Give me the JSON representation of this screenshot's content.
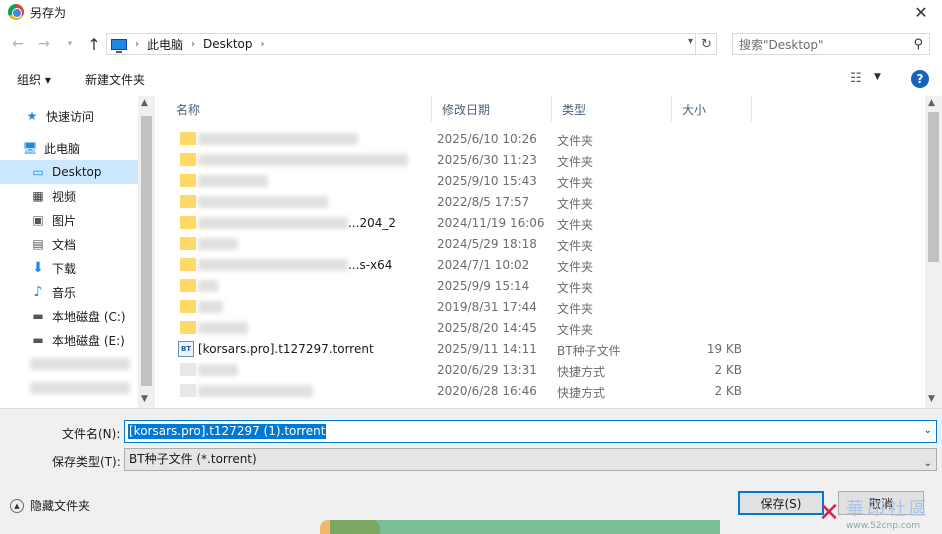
{
  "window": {
    "title": "另存为"
  },
  "address": {
    "crumbs": [
      "此电脑",
      "Desktop"
    ]
  },
  "search": {
    "placeholder": "搜索\"Desktop\""
  },
  "toolbar": {
    "organize": "组织 ▾",
    "new_folder": "新建文件夹"
  },
  "nav": {
    "items": [
      {
        "label": "快速访问",
        "icon": "star-icon"
      },
      {
        "label": "此电脑",
        "icon": "pc-icon"
      },
      {
        "label": "Desktop",
        "icon": "desktop-icon",
        "selected": true
      },
      {
        "label": "视频",
        "icon": "video-icon"
      },
      {
        "label": "图片",
        "icon": "picture-icon"
      },
      {
        "label": "文档",
        "icon": "document-icon"
      },
      {
        "label": "下载",
        "icon": "download-icon"
      },
      {
        "label": "音乐",
        "icon": "music-icon"
      },
      {
        "label": "本地磁盘 (C:)",
        "icon": "drive-icon"
      },
      {
        "label": "本地磁盘 (E:)",
        "icon": "drive-icon"
      }
    ]
  },
  "columns": {
    "name": "名称",
    "date": "修改日期",
    "type": "类型",
    "size": "大小"
  },
  "files": [
    {
      "name": "",
      "date": "2025/6/10 10:26",
      "type": "文件夹",
      "size": ""
    },
    {
      "name": "",
      "date": "2025/6/30 11:23",
      "type": "文件夹",
      "size": ""
    },
    {
      "name": "",
      "date": "2025/9/10 15:43",
      "type": "文件夹",
      "size": ""
    },
    {
      "name": "",
      "date": "2022/8/5 17:57",
      "type": "文件夹",
      "size": ""
    },
    {
      "name": "...204_2",
      "date": "2024/11/19 16:06",
      "type": "文件夹",
      "size": ""
    },
    {
      "name": "",
      "date": "2024/5/29 18:18",
      "type": "文件夹",
      "size": ""
    },
    {
      "name": "...s-x64",
      "date": "2024/7/1 10:02",
      "type": "文件夹",
      "size": ""
    },
    {
      "name": "",
      "date": "2025/9/9 15:14",
      "type": "文件夹",
      "size": ""
    },
    {
      "name": "",
      "date": "2019/8/31 17:44",
      "type": "文件夹",
      "size": ""
    },
    {
      "name": "",
      "date": "2025/8/20 14:45",
      "type": "文件夹",
      "size": ""
    },
    {
      "name": "[korsars.pro].t127297.torrent",
      "date": "2025/9/11 14:11",
      "type": "BT种子文件",
      "size": "19 KB"
    },
    {
      "name": "",
      "date": "2020/6/29 13:31",
      "type": "快捷方式",
      "size": "2 KB"
    },
    {
      "name": "",
      "date": "2020/6/28 16:46",
      "type": "快捷方式",
      "size": "2 KB"
    }
  ],
  "form": {
    "filename_label": "文件名(N):",
    "filename_value": "[korsars.pro].t127297 (1).torrent",
    "filetype_label": "保存类型(T):",
    "filetype_value": "BT种子文件 (*.torrent)"
  },
  "footer": {
    "hide_folders": "隐藏文件夹",
    "save": "保存(S)",
    "cancel": "取消"
  },
  "watermark": {
    "name": "華印社區",
    "url": "www.52cnp.com"
  }
}
